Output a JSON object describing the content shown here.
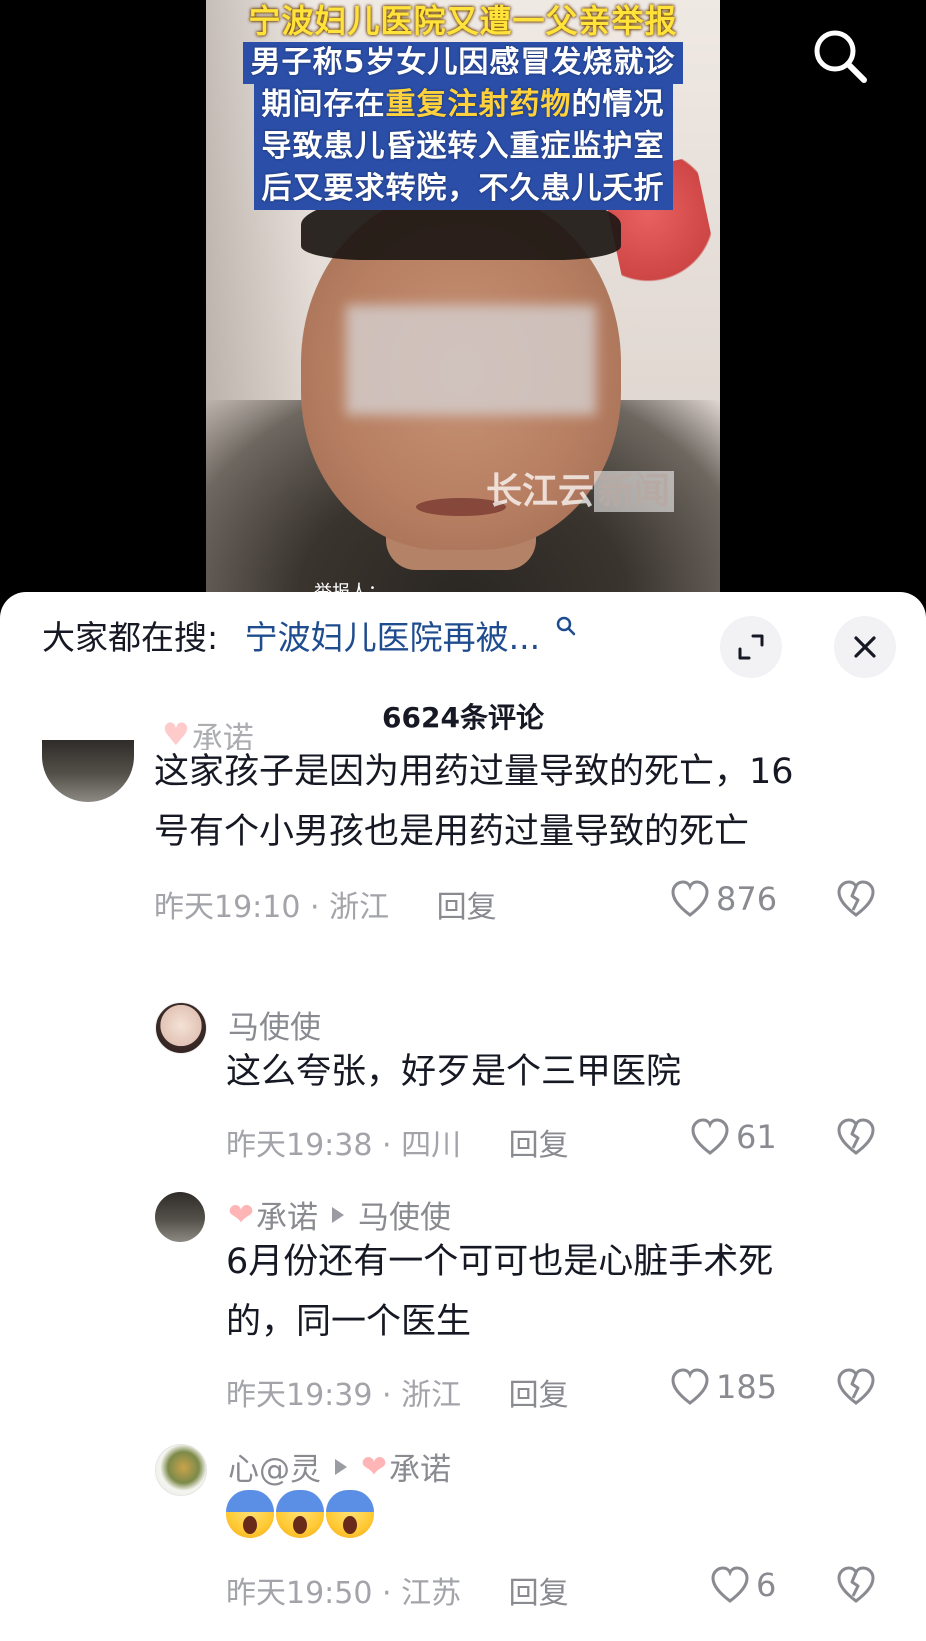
{
  "video": {
    "caption_lines": [
      "宁波妇儿医院又遭一父亲举报",
      "男子称5岁女儿因感冒发烧就诊",
      "期间存在",
      "重复注射药物",
      "的情况",
      "导致患儿昏迷转入重症监护室",
      "后又要求转院，不久患儿夭折"
    ],
    "watermark_left": "长江云",
    "watermark_right": "新闻",
    "reporter_label": "举报人：",
    "search_icon": "search-icon"
  },
  "panel": {
    "search_label": "大家都在搜:",
    "search_term": "宁波妇儿医院再被...",
    "comment_count": "6624条评论",
    "icons": {
      "expand": "expand-icon",
      "close": "close-icon"
    }
  },
  "comments": [
    {
      "user": "承诺",
      "text_line1": "这家孩子是因为用药过量导致的死亡，16",
      "text_line2": "号有个小男孩也是用药过量导致的死亡",
      "time": "昨天19:10",
      "location": "浙江",
      "reply": "回复",
      "likes": "876"
    },
    {
      "user": "马使使",
      "text": "这么夸张，好歹是个三甲医院",
      "time": "昨天19:38",
      "location": "四川",
      "reply": "回复",
      "likes": "61"
    },
    {
      "user": "承诺",
      "reply_to": "马使使",
      "text_line1": "6月份还有一个可可也是心脏手术死",
      "text_line2": "的，同一个医生",
      "time": "昨天19:39",
      "location": "浙江",
      "reply": "回复",
      "likes": "185"
    },
    {
      "user": "心@灵",
      "reply_to": "承诺",
      "emoji": "scream-emoji",
      "time": "昨天19:50",
      "location": "江苏",
      "reply": "回复",
      "likes": "6"
    }
  ],
  "colors": {
    "link_blue": "#1f4c8f",
    "caption_blue": "#2b4fa8",
    "caption_yellow": "#ffd23b",
    "meta_gray": "#a3a4a9"
  }
}
